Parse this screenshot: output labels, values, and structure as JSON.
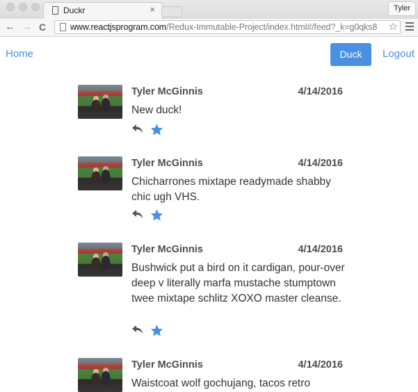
{
  "browser": {
    "tab_title": "Duckr",
    "tab_close": "×",
    "profile_name": "Tyler",
    "back": "←",
    "forward": "→",
    "reload": "C",
    "url_host": "www.reactjsprogram.com",
    "url_path": "/Redux-Immutable-Project/index.html#/feed?_k=g0qks8",
    "bookmark_star": "☆"
  },
  "nav": {
    "home": "Home",
    "duck": "Duck",
    "logout": "Logout"
  },
  "colors": {
    "accent": "#4a90e2",
    "text": "#333333",
    "author": "#4c4c4c"
  },
  "feed": [
    {
      "author": "Tyler McGinnis",
      "date": "4/14/2016",
      "text": "New duck!",
      "liked": true
    },
    {
      "author": "Tyler McGinnis",
      "date": "4/14/2016",
      "text": "Chicharrones mixtape readymade shabby chic ugh VHS.",
      "liked": true
    },
    {
      "author": "Tyler McGinnis",
      "date": "4/14/2016",
      "text": "Bushwick put a bird on it cardigan, pour-over deep v literally marfa mustache stumptown twee mixtape schlitz XOXO master cleanse.",
      "liked": true
    },
    {
      "author": "Tyler McGinnis",
      "date": "4/14/2016",
      "text": "Waistcoat wolf gochujang, tacos retro",
      "liked": true
    }
  ]
}
